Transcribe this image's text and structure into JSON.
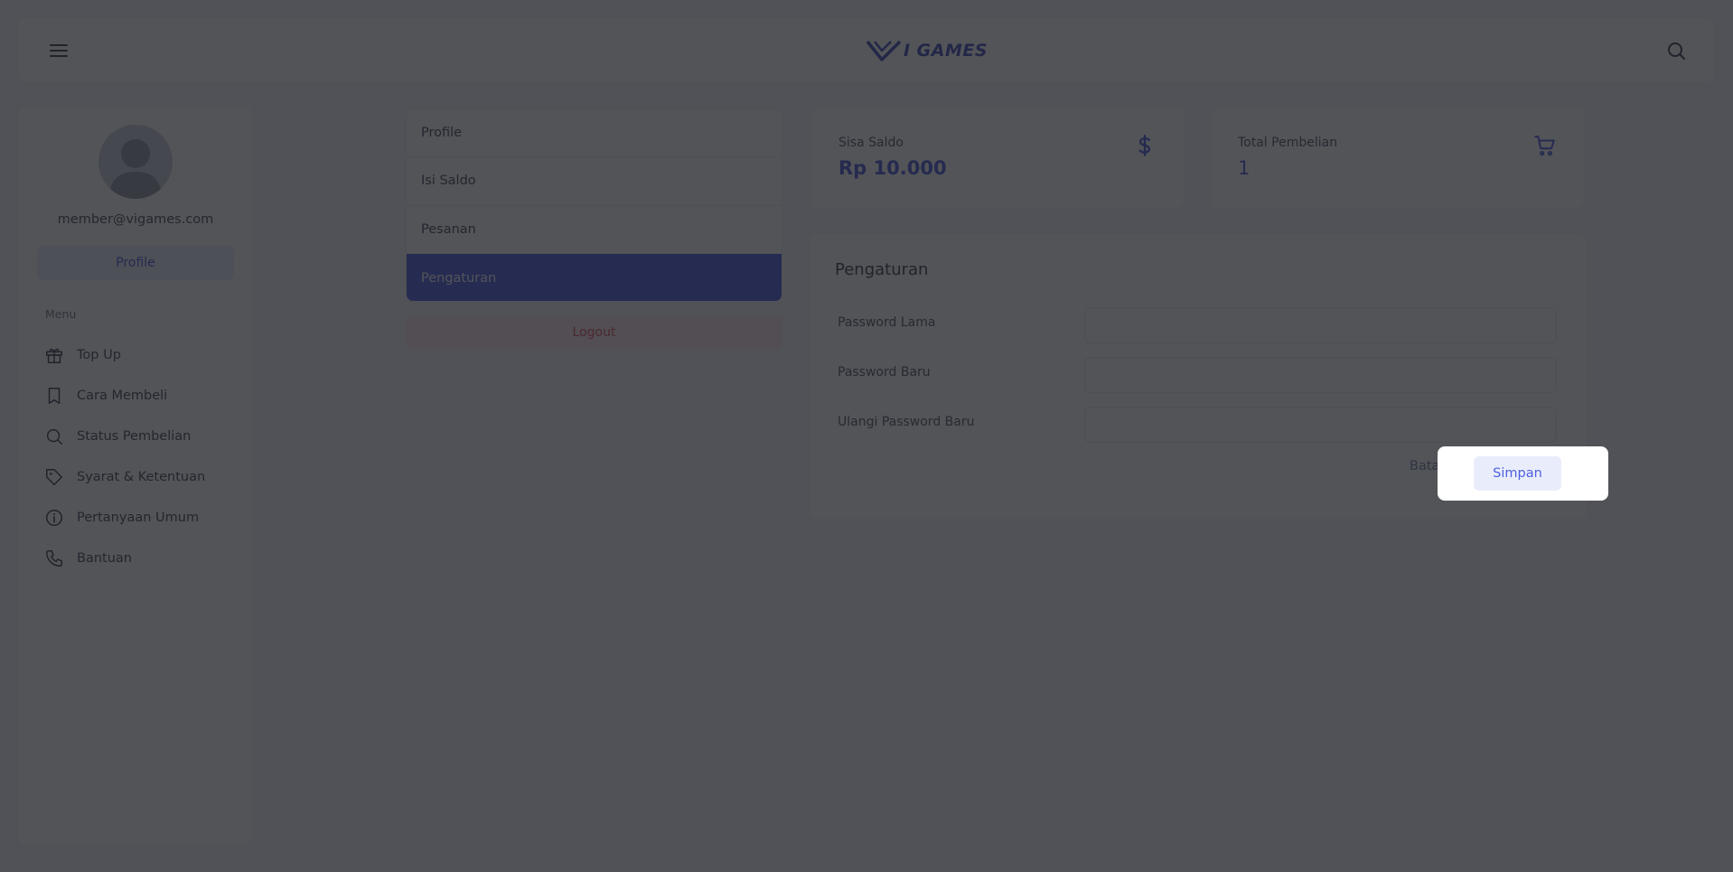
{
  "app": {
    "logo_text": "I GAMES",
    "brand_color": "#4a55e0"
  },
  "header": {
    "menu_icon": "hamburger-icon",
    "search_icon": "search-icon"
  },
  "sidebar": {
    "email": "member@vigames.com",
    "profile_button": "Profile",
    "menu_label": "Menu",
    "items": [
      {
        "label": "Top Up",
        "icon": "gift-icon"
      },
      {
        "label": "Cara Membeli",
        "icon": "bookmark-icon"
      },
      {
        "label": "Status Pembelian",
        "icon": "search-icon"
      },
      {
        "label": "Syarat & Ketentuan",
        "icon": "tag-icon"
      },
      {
        "label": "Pertanyaan Umum",
        "icon": "info-icon"
      },
      {
        "label": "Bantuan",
        "icon": "phone-icon"
      }
    ]
  },
  "account_nav": {
    "items": [
      {
        "label": "Profile",
        "active": false
      },
      {
        "label": "Isi Saldo",
        "active": false
      },
      {
        "label": "Pesanan",
        "active": false
      },
      {
        "label": "Pengaturan",
        "active": true
      }
    ],
    "logout_label": "Logout"
  },
  "stats": {
    "saldo": {
      "label": "Sisa Saldo",
      "value": "Rp 10.000",
      "icon": "dollar-icon"
    },
    "total": {
      "label": "Total Pembelian",
      "value": "1",
      "icon": "cart-icon"
    }
  },
  "settings": {
    "title": "Pengaturan",
    "fields": [
      {
        "label": "Password Lama",
        "value": ""
      },
      {
        "label": "Password Baru",
        "value": ""
      },
      {
        "label": "Ulangi Password Baru",
        "value": ""
      }
    ],
    "cancel_label": "Batal",
    "save_label": "Simpan"
  }
}
